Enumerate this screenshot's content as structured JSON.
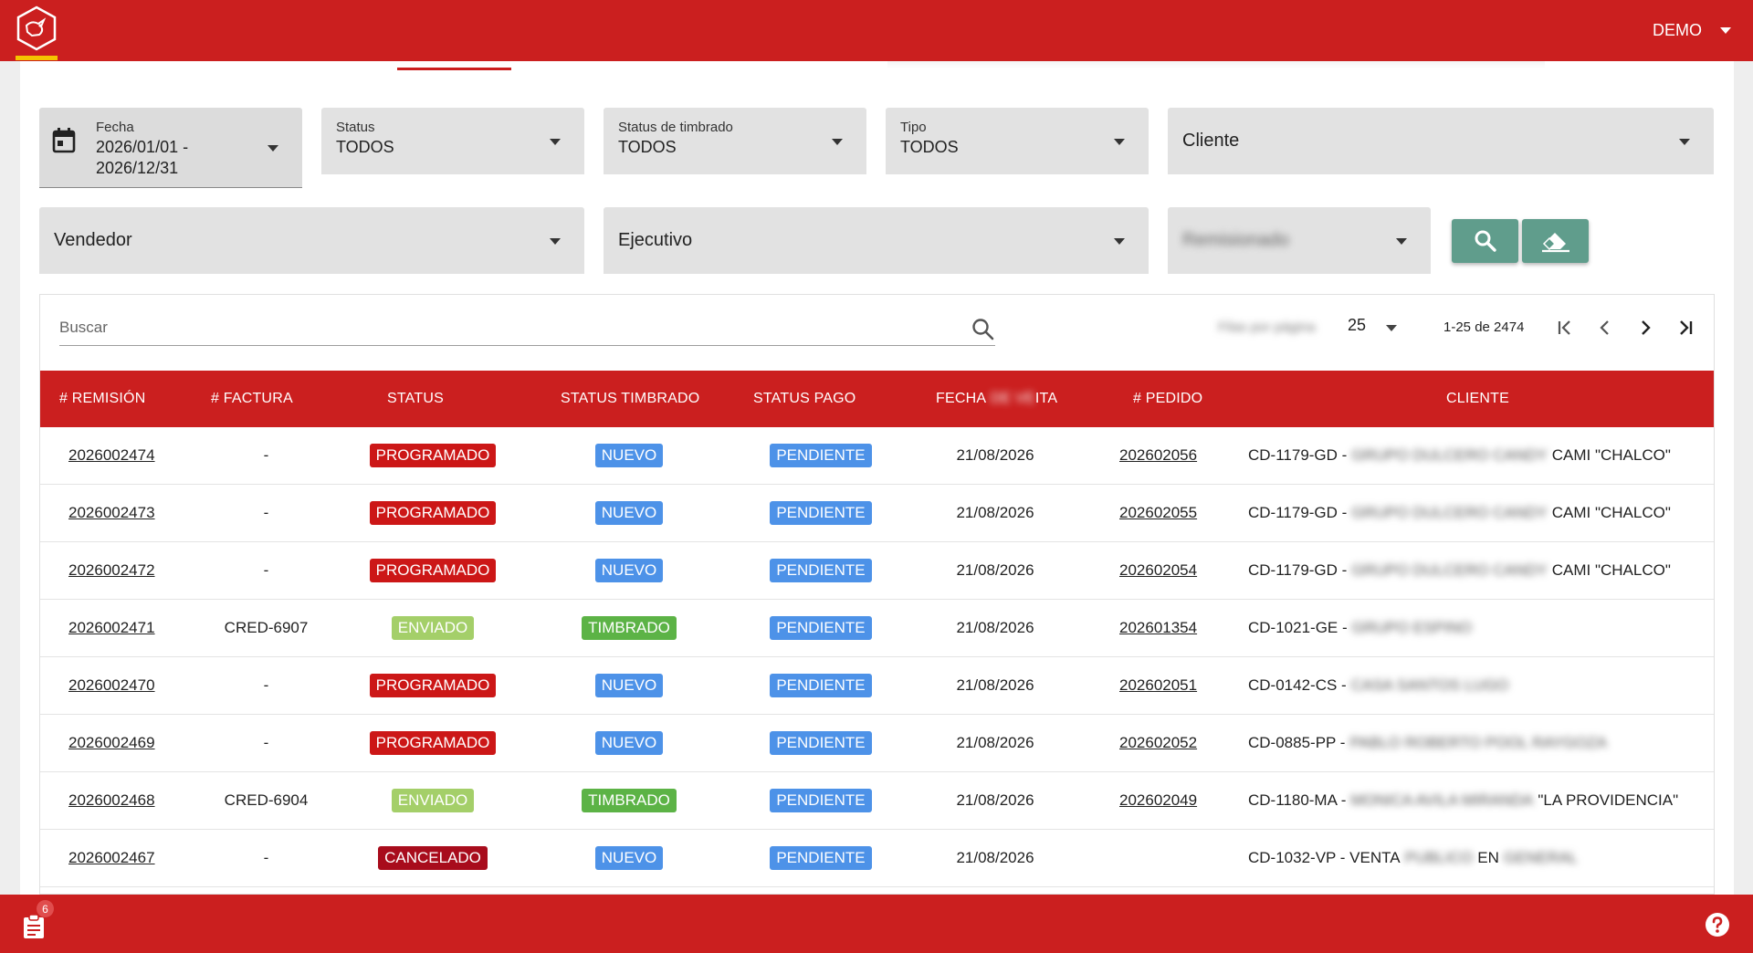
{
  "header": {
    "user_label": "DEMO"
  },
  "filters": {
    "fecha": {
      "label": "Fecha",
      "value_line1": "2026/01/01 -",
      "value_line2": "2026/12/31"
    },
    "status": {
      "label": "Status",
      "value": "TODOS"
    },
    "status_timbrado": {
      "label": "Status de timbrado",
      "value": "TODOS"
    },
    "tipo": {
      "label": "Tipo",
      "value": "TODOS"
    },
    "cliente": {
      "label": "Cliente"
    },
    "vendedor": {
      "label": "Vendedor"
    },
    "ejecutivo": {
      "label": "Ejecutivo"
    },
    "remisionado": {
      "label": "Remisionado"
    }
  },
  "search": {
    "placeholder": "Buscar"
  },
  "pagination": {
    "rows_label": "Filas por página",
    "rows_value": "25",
    "range": "1-25 de 2474"
  },
  "table": {
    "columns": {
      "remision": "# REMISIÓN",
      "factura": "# FACTURA",
      "status": "STATUS",
      "status_timbrado": "STATUS TIMBRADO",
      "status_pago": "STATUS PAGO",
      "fecha_a": "FECHA",
      "fecha_blur": "DE VE",
      "fecha_b": "ITA",
      "pedido": "# PEDIDO",
      "cliente": "CLIENTE"
    },
    "rows": [
      {
        "remision": "2026002474",
        "factura": "-",
        "status": "PROGRAMADO",
        "timbrado": "NUEVO",
        "pago": "PENDIENTE",
        "fecha": "21/08/2026",
        "pedido": "202602056",
        "cliente_a": "CD-1179-GD -",
        "cliente_blur": "GRUPO DULCERO CANDY",
        "cliente_b": "CAMI \"CHALCO\""
      },
      {
        "remision": "2026002473",
        "factura": "-",
        "status": "PROGRAMADO",
        "timbrado": "NUEVO",
        "pago": "PENDIENTE",
        "fecha": "21/08/2026",
        "pedido": "202602055",
        "cliente_a": "CD-1179-GD -",
        "cliente_blur": "GRUPO DULCERO CANDY",
        "cliente_b": "CAMI \"CHALCO\""
      },
      {
        "remision": "2026002472",
        "factura": "-",
        "status": "PROGRAMADO",
        "timbrado": "NUEVO",
        "pago": "PENDIENTE",
        "fecha": "21/08/2026",
        "pedido": "202602054",
        "cliente_a": "CD-1179-GD -",
        "cliente_blur": "GRUPO DULCERO CANDY",
        "cliente_b": "CAMI \"CHALCO\""
      },
      {
        "remision": "2026002471",
        "factura": "CRED-6907",
        "status": "ENVIADO",
        "timbrado": "TIMBRADO",
        "pago": "PENDIENTE",
        "fecha": "21/08/2026",
        "pedido": "202601354",
        "cliente_a": "CD-1021-GE -",
        "cliente_blur": "GRUPO ESPINO",
        "cliente_b": ""
      },
      {
        "remision": "2026002470",
        "factura": "-",
        "status": "PROGRAMADO",
        "timbrado": "NUEVO",
        "pago": "PENDIENTE",
        "fecha": "21/08/2026",
        "pedido": "202602051",
        "cliente_a": "CD-0142-CS -",
        "cliente_blur": "CASA SANTOS LUGO",
        "cliente_b": ""
      },
      {
        "remision": "2026002469",
        "factura": "-",
        "status": "PROGRAMADO",
        "timbrado": "NUEVO",
        "pago": "PENDIENTE",
        "fecha": "21/08/2026",
        "pedido": "202602052",
        "cliente_a": "CD-0885-PP -",
        "cliente_blur": "PABLO ROBERTO POOL RAYGOZA",
        "cliente_b": ""
      },
      {
        "remision": "2026002468",
        "factura": "CRED-6904",
        "status": "ENVIADO",
        "timbrado": "TIMBRADO",
        "pago": "PENDIENTE",
        "fecha": "21/08/2026",
        "pedido": "202602049",
        "cliente_a": "CD-1180-MA -",
        "cliente_blur": "MONICA AVILA MIRANDA",
        "cliente_b": "\"LA PROVIDENCIA\""
      },
      {
        "remision": "2026002467",
        "factura": "-",
        "status": "CANCELADO",
        "timbrado": "NUEVO",
        "pago": "PENDIENTE",
        "fecha": "21/08/2026",
        "pedido": "",
        "cliente_a": "CD-1032-VP - VENTA",
        "cliente_blur": "PUBLICO",
        "cliente_b": "EN",
        "cliente_blur2": "GENERAL"
      }
    ]
  },
  "footer": {
    "notifications_count": "6"
  },
  "colors": {
    "brand_red": "#cb1f1f",
    "action_green": "#609d8c",
    "programado": "#cc1717",
    "enviado": "#a4cf69",
    "cancelado": "#a80c1c",
    "nuevo": "#4d92e8",
    "timbrado": "#5cb346",
    "pendiente": "#4d92e8"
  },
  "icons": [
    "logo-icon",
    "calendar-icon",
    "search-icon",
    "eraser-icon",
    "first-page-icon",
    "prev-page-icon",
    "next-page-icon",
    "last-page-icon",
    "clipboard-icon",
    "help-icon"
  ]
}
